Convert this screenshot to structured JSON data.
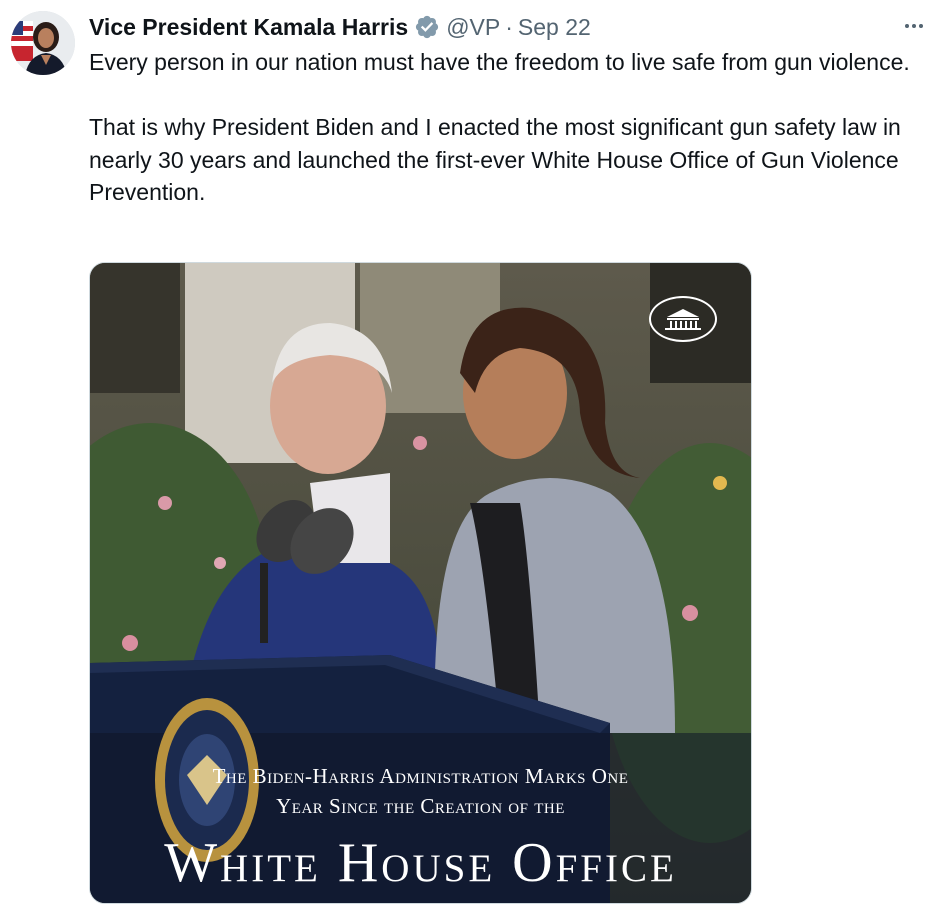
{
  "author": {
    "display_name": "Vice President Kamala Harris",
    "handle": "@VP",
    "separator": "·",
    "date": "Sep 22",
    "verified_badge_icon": "verified-badge-icon",
    "badge_color": "#829aab"
  },
  "tweet": {
    "paragraphs": [
      "Every person in our nation must have the freedom to live safe from gun violence.",
      "That is why President Biden and I enacted the most significant gun safety law in nearly 30 years and launched the first-ever White House Office of Gun Violence Prevention."
    ]
  },
  "media": {
    "caption_line1": "The Biden-Harris Administration Marks One",
    "caption_line2": "Year Since the Creation of the",
    "caption_big": "White House Office"
  },
  "icons": {
    "more": "more-options-icon",
    "white_house": "white-house-logo-icon",
    "seal": "presidential-seal-icon"
  }
}
